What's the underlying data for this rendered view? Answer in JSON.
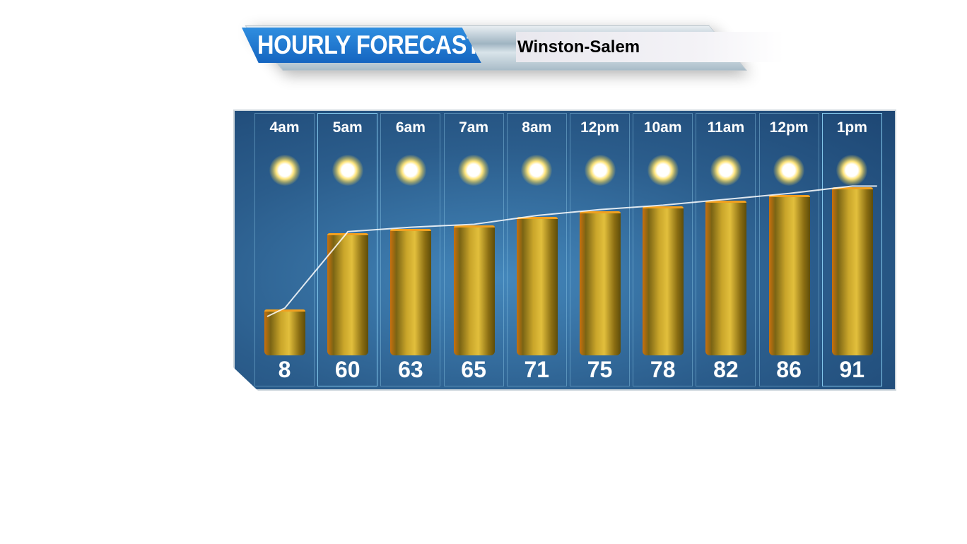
{
  "header": {
    "title": "HOURLY FORECAST",
    "location": "Winston-Salem"
  },
  "chart_data": {
    "type": "bar",
    "categories": [
      "4am",
      "5am",
      "6am",
      "7am",
      "8am",
      "12pm",
      "10am",
      "11am",
      "12pm",
      "1pm"
    ],
    "values": [
      8,
      60,
      63,
      65,
      71,
      75,
      78,
      82,
      86,
      91
    ],
    "icons": [
      "sun-icon",
      "sun-icon",
      "sun-icon",
      "sun-icon",
      "sun-icon",
      "sun-icon",
      "sun-icon",
      "sun-icon",
      "sun-icon",
      "sun-icon"
    ],
    "bar_color": "#d4af2f",
    "background_color": "#2b5d8c"
  }
}
